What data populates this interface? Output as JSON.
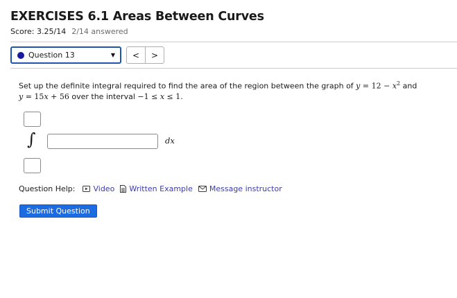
{
  "header": {
    "title": "EXERCISES 6.1 Areas Between Curves",
    "score": "Score: 3.25/14",
    "answered": "2/14 answered"
  },
  "navigation": {
    "question_selected": "Question 13",
    "prev_label": "<",
    "next_label": ">"
  },
  "question": {
    "text_1": "Set up the definite integral required to find the area of the region between the graph of ",
    "y1": "y",
    "eq1": " = 12 − ",
    "x1": "x",
    "sup": "2",
    "and": " and",
    "y2": "y",
    "eq2": " = 15",
    "x2": "x",
    "eq2b": " + 56",
    "text_2": " over the interval ",
    "int_a": "−1 ≤ ",
    "int_x": "x",
    "int_b": " ≤ 1.",
    "upper_limit_value": "",
    "lower_limit_value": "",
    "integrand_value": "",
    "dx_label": "dx"
  },
  "help": {
    "label": "Question Help:",
    "video": "Video",
    "written_example": "Written Example",
    "message": "Message instructor"
  },
  "submit_label": "Submit Question",
  "colors": {
    "accent": "#1d54b4",
    "link": "#3a3ab0",
    "button": "#1d6be0"
  }
}
